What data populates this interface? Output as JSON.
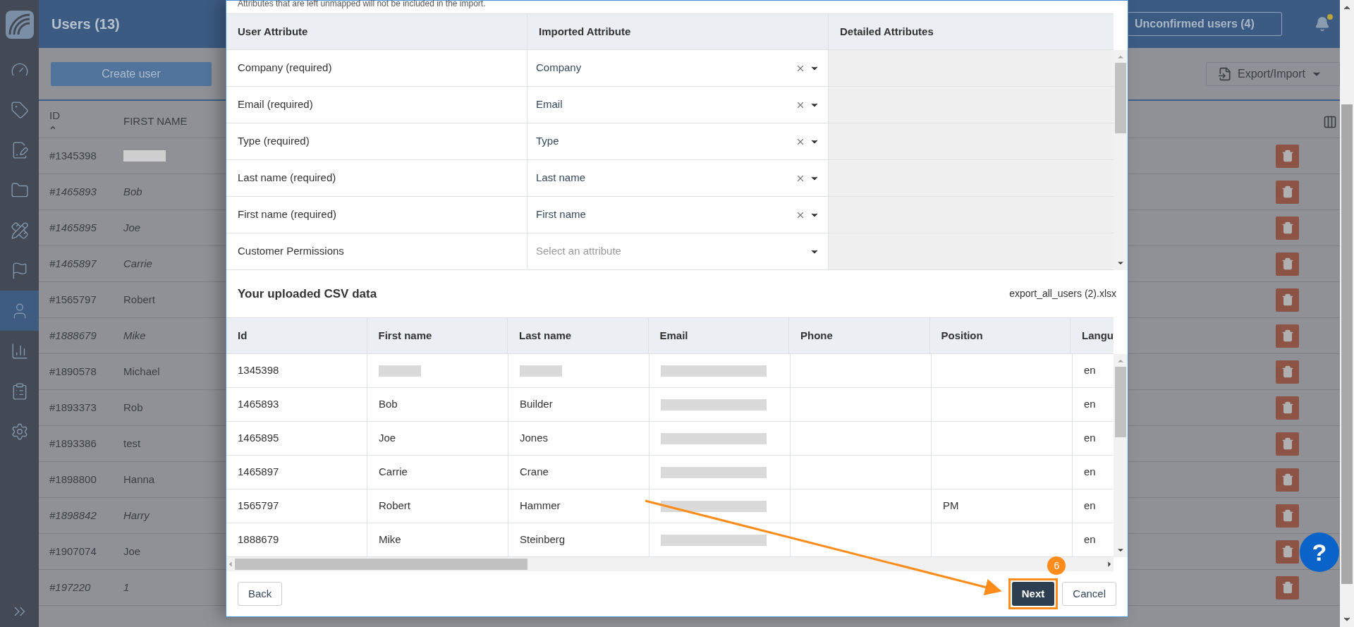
{
  "sidebar": {
    "items": [
      {
        "selected": false
      },
      {
        "selected": false
      },
      {
        "selected": false
      },
      {
        "selected": false
      },
      {
        "selected": false
      },
      {
        "selected": false
      },
      {
        "selected": true
      },
      {
        "selected": false
      },
      {
        "selected": false
      },
      {
        "selected": false
      }
    ]
  },
  "header": {
    "title": "Users (13)",
    "unconfirmed_button": "Unconfirmed users (4)",
    "has_notification": true
  },
  "toolbar": {
    "create_button": "Create user",
    "export_button": "Export/Import"
  },
  "users_table": {
    "columns": [
      {
        "label": "ID",
        "sorted": true
      },
      {
        "label": "FIRST NAME",
        "sorted": false
      }
    ],
    "rows": [
      {
        "id": "#1345398",
        "first_name": null,
        "unconfirmed": false
      },
      {
        "id": "#1465893",
        "first_name": "Bob",
        "unconfirmed": true
      },
      {
        "id": "#1465895",
        "first_name": "Joe",
        "unconfirmed": true
      },
      {
        "id": "#1465897",
        "first_name": "Carrie",
        "unconfirmed": true
      },
      {
        "id": "#1565797",
        "first_name": "Robert",
        "unconfirmed": false
      },
      {
        "id": "#1888679",
        "first_name": "Mike",
        "unconfirmed": true
      },
      {
        "id": "#1890578",
        "first_name": "Michael",
        "unconfirmed": false
      },
      {
        "id": "#1893373",
        "first_name": "Rob",
        "unconfirmed": false
      },
      {
        "id": "#1893386",
        "first_name": "test",
        "unconfirmed": false
      },
      {
        "id": "#1898800",
        "first_name": "Hanna",
        "unconfirmed": false
      },
      {
        "id": "#1898842",
        "first_name": "Harry",
        "unconfirmed": true
      },
      {
        "id": "#1907074",
        "first_name": "Joe",
        "unconfirmed": false
      },
      {
        "id": "#197220",
        "first_name": "1",
        "unconfirmed": true
      }
    ]
  },
  "modal": {
    "note": "Attributes that are left unmapped will not be included in the import.",
    "mapping": {
      "columns": [
        "User Attribute",
        "Imported Attribute",
        "Detailed Attributes"
      ],
      "rows": [
        {
          "attribute": "Company (required)",
          "value": "Company"
        },
        {
          "attribute": "Email (required)",
          "value": "Email"
        },
        {
          "attribute": "Type (required)",
          "value": "Type"
        },
        {
          "attribute": "Last name (required)",
          "value": "Last name"
        },
        {
          "attribute": "First name (required)",
          "value": "First name"
        },
        {
          "attribute": "Customer Permissions",
          "placeholder": "Select an attribute"
        }
      ]
    },
    "csv": {
      "title": "Your uploaded CSV data",
      "file_name": "export_all_users (2).xlsx",
      "columns": [
        "Id",
        "First name",
        "Last name",
        "Email",
        "Phone",
        "Position",
        "Langu"
      ],
      "rows": [
        [
          "1345398",
          null,
          null,
          null,
          "",
          "",
          "en"
        ],
        [
          "1465893",
          "Bob",
          "Builder",
          null,
          "",
          "",
          "en"
        ],
        [
          "1465895",
          "Joe",
          "Jones",
          null,
          "",
          "",
          "en"
        ],
        [
          "1465897",
          "Carrie",
          "Crane",
          null,
          "",
          "",
          "en"
        ],
        [
          "1565797",
          "Robert",
          "Hammer",
          null,
          "",
          "PM",
          "en"
        ],
        [
          "1888679",
          "Mike",
          "Steinberg",
          null,
          "",
          "",
          "en"
        ]
      ]
    },
    "buttons": {
      "back": "Back",
      "next": "Next",
      "cancel": "Cancel"
    }
  },
  "annotation": {
    "step": "6"
  },
  "help_button": "?"
}
